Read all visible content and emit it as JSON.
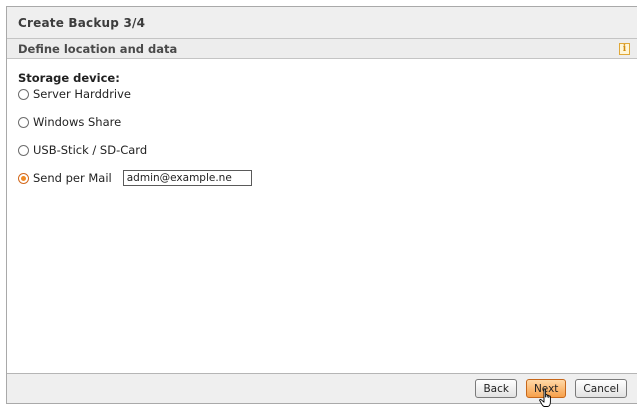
{
  "dialog": {
    "title": "Create Backup 3/4",
    "section_title": "Define location and data",
    "info_icon": "info-icon"
  },
  "storage": {
    "label": "Storage device:",
    "options": [
      {
        "label": "Server Harddrive",
        "selected": false
      },
      {
        "label": "Windows Share",
        "selected": false
      },
      {
        "label": "USB-Stick / SD-Card",
        "selected": false
      },
      {
        "label": "Send per Mail",
        "selected": true
      }
    ],
    "email_value": "admin@example.ne"
  },
  "footer": {
    "back_label": "Back",
    "next_label": "Next",
    "cancel_label": "Cancel"
  },
  "colors": {
    "accent": "#f08a24",
    "panel": "#efefef"
  }
}
